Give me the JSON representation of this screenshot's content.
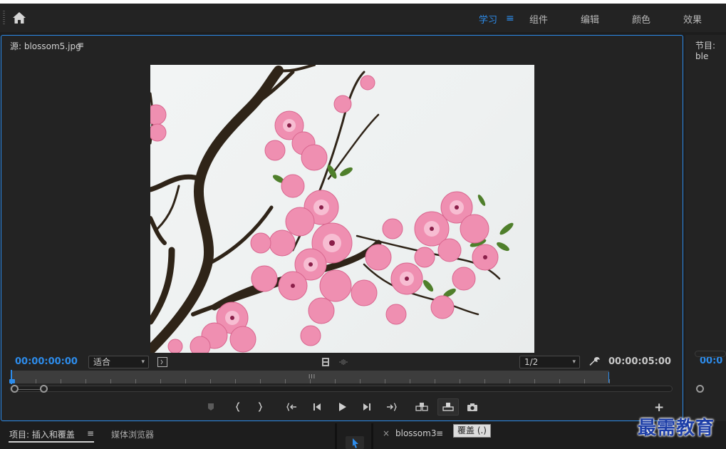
{
  "header": {
    "workspaces": [
      "学习",
      "组件",
      "编辑",
      "颜色",
      "效果"
    ],
    "active_workspace": "学习",
    "menu_glyph": "≡",
    "icons": {
      "home": "home-icon",
      "grip": "drag-grip-icon"
    }
  },
  "source_panel": {
    "title": "源: blossom5.jpg",
    "menu": "≡",
    "timecode_left": "00:00:00:00",
    "fit_select": "适合",
    "resolution_select": "1/2",
    "timecode_right": "00:00:05:00",
    "ruler_marker": "III",
    "image": "cherry-blossom-branch",
    "controls": [
      "add-marker",
      "mark-in",
      "mark-out",
      "go-to-in",
      "step-back",
      "play",
      "step-forward",
      "go-to-out",
      "insert",
      "overwrite",
      "export-frame"
    ],
    "add_button": "+"
  },
  "program_panel": {
    "title": "节目: ble",
    "timecode": "00:0"
  },
  "bottom": {
    "project_tab": "项目: 插入和覆盖",
    "project_menu": "≡",
    "media_browser_tab": "媒体浏览器",
    "sequence_close": "×",
    "sequence_tab": "blossom3",
    "sequence_menu": "≡",
    "tooltip": "覆盖 (.)"
  },
  "watermark": "最需教育",
  "colors": {
    "accent": "#2d8ceb",
    "panel": "#232323",
    "background": "#1d1d1d"
  }
}
